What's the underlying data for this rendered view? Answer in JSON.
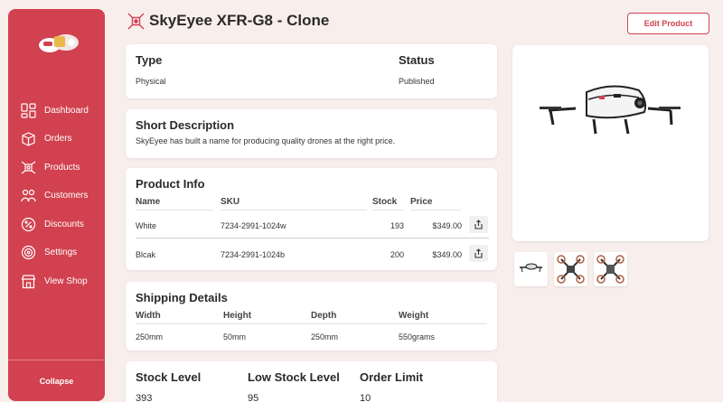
{
  "sidebar": {
    "items": [
      {
        "label": "Dashboard",
        "icon": "dashboard-icon"
      },
      {
        "label": "Orders",
        "icon": "orders-box-icon"
      },
      {
        "label": "Products",
        "icon": "products-drone-icon"
      },
      {
        "label": "Customers",
        "icon": "customers-icon"
      },
      {
        "label": "Discounts",
        "icon": "discount-percent-icon"
      },
      {
        "label": "Settings",
        "icon": "settings-target-icon"
      },
      {
        "label": "View Shop",
        "icon": "shop-storefront-icon"
      }
    ],
    "collapse_label": "Collapse"
  },
  "header": {
    "title": "SkyEyee XFR-G8 - Clone",
    "edit_label": "Edit Product"
  },
  "type_card": {
    "type_label": "Type",
    "type_value": "Physical",
    "status_label": "Status",
    "status_value": "Published"
  },
  "description_card": {
    "title": "Short Description",
    "text": "SkyEyee has built a name for producing quality drones at the right price."
  },
  "product_info": {
    "title": "Product Info",
    "columns": [
      "Name",
      "SKU",
      "Stock",
      "Price"
    ],
    "rows": [
      {
        "name": "White",
        "sku": "7234-2991-1024w",
        "stock": "193",
        "price": "$349.00"
      },
      {
        "name": "Blcak",
        "sku": "7234-2991-1024b",
        "stock": "200",
        "price": "$349.00"
      }
    ]
  },
  "shipping": {
    "title": "Shipping Details",
    "columns": [
      "Width",
      "Height",
      "Depth",
      "Weight"
    ],
    "values": [
      "250mm",
      "50mm",
      "250mm",
      "550grams"
    ]
  },
  "stock": {
    "labels": [
      "Stock Level",
      "Low Stock Level",
      "Order Limit"
    ],
    "values": [
      "393",
      "95",
      "10"
    ]
  },
  "colors": {
    "accent": "#d1414f",
    "background": "#f8efed"
  }
}
